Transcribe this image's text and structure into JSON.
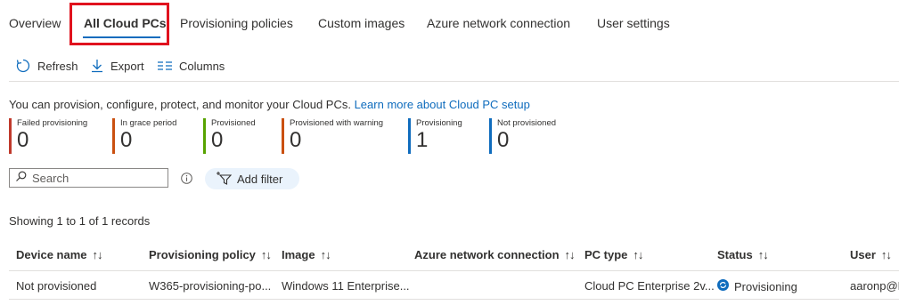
{
  "tabs": [
    {
      "label": "Overview"
    },
    {
      "label": "All Cloud PCs"
    },
    {
      "label": "Provisioning policies"
    },
    {
      "label": "Custom images"
    },
    {
      "label": "Azure network connection"
    },
    {
      "label": "User settings"
    }
  ],
  "toolbar": {
    "refresh_label": "Refresh",
    "export_label": "Export",
    "columns_label": "Columns"
  },
  "info": {
    "text": "You can provision, configure, protect, and monitor your Cloud PCs.",
    "link": "Learn more about Cloud PC setup"
  },
  "stats": [
    {
      "label": "Failed provisioning",
      "value": "0",
      "color": "#c0392b"
    },
    {
      "label": "In grace period",
      "value": "0",
      "color": "#ca5010"
    },
    {
      "label": "Provisioned",
      "value": "0",
      "color": "#57a300"
    },
    {
      "label": "Provisioned with warning",
      "value": "0",
      "color": "#ca5010"
    },
    {
      "label": "Provisioning",
      "value": "1",
      "color": "#0f6cbd"
    },
    {
      "label": "Not provisioned",
      "value": "0",
      "color": "#0f6cbd"
    }
  ],
  "search": {
    "placeholder": "Search"
  },
  "filter": {
    "label": "Add filter"
  },
  "records": "Showing 1 to 1 of 1 records",
  "table": {
    "columns": [
      "Device name",
      "Provisioning policy",
      "Image",
      "Azure network connection",
      "PC type",
      "Status",
      "User"
    ],
    "sort_glyph": "↑↓",
    "rows": [
      {
        "device_name": "Not provisioned",
        "policy": "W365-provisioning-po...",
        "image": "Windows 11 Enterprise...",
        "network": "",
        "pc_type": "Cloud PC Enterprise 2v...",
        "status": "Provisioning",
        "user": "aaronp@M"
      }
    ]
  }
}
